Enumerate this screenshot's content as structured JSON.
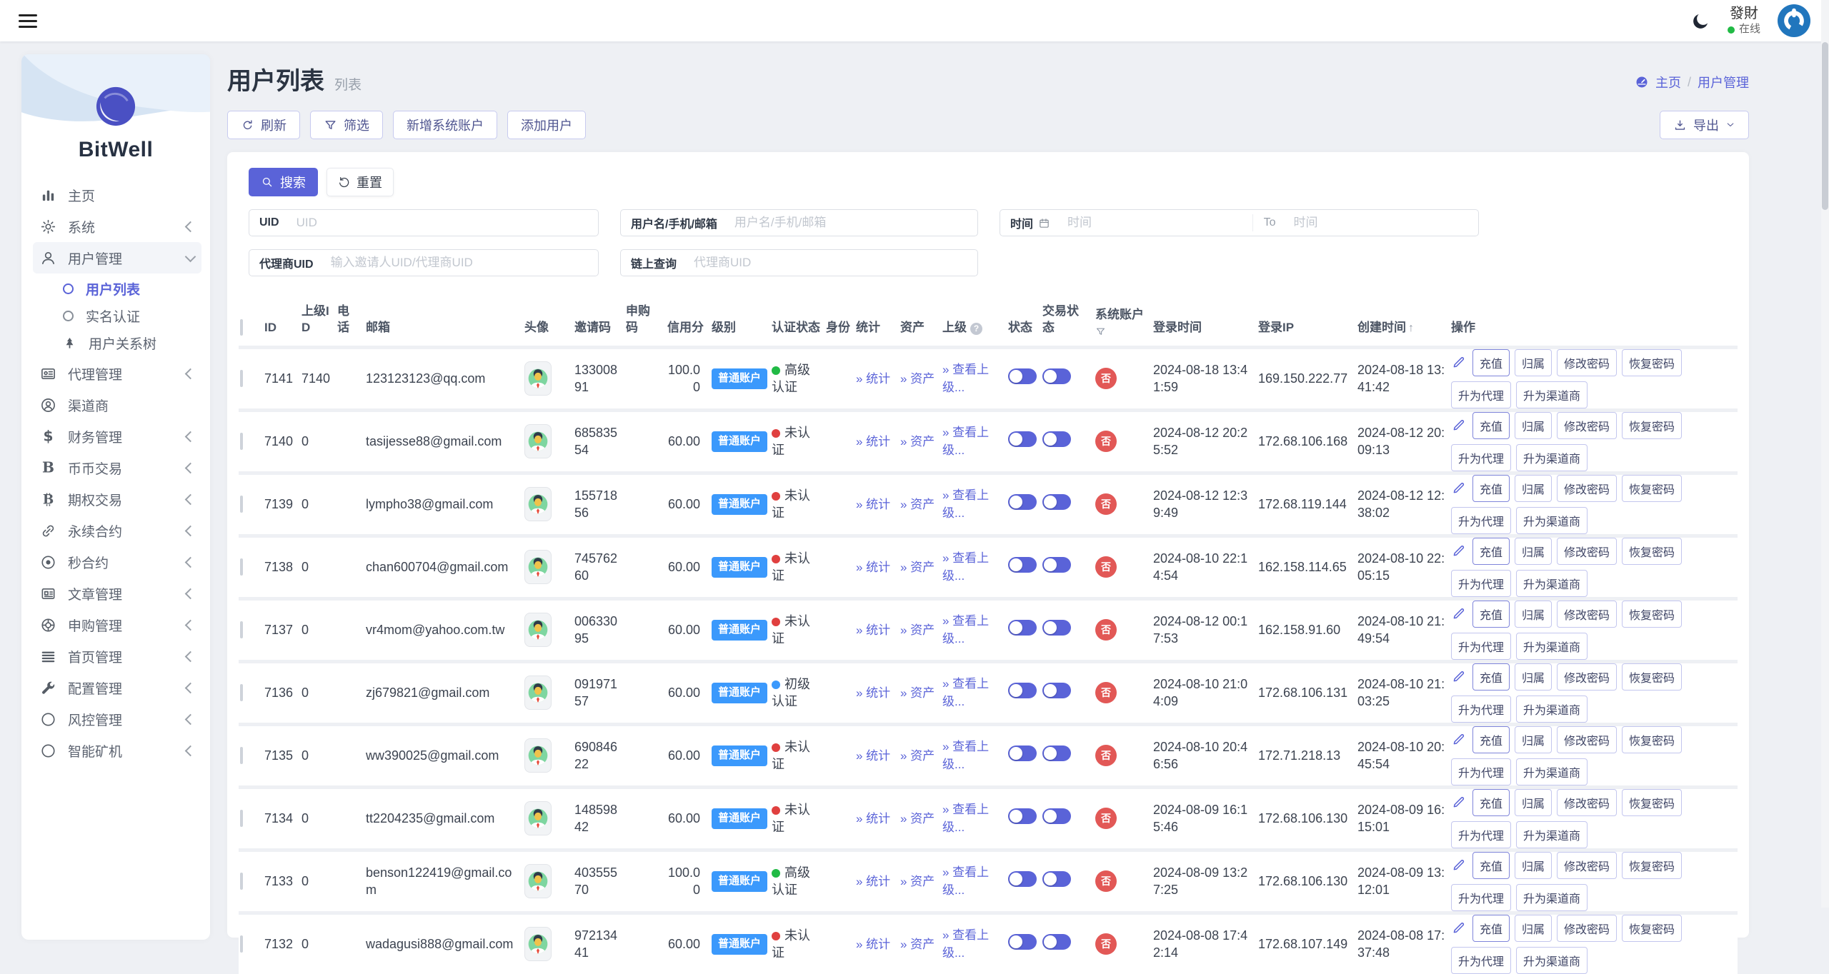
{
  "topbar": {
    "user_name": "發財",
    "user_status": "在线"
  },
  "sidebar": {
    "brand": "BitWell",
    "menu": [
      {
        "icon": "chart-bars-icon",
        "label": "主页"
      },
      {
        "icon": "gear-icon",
        "label": "系统",
        "chevron": "left"
      },
      {
        "icon": "user-icon",
        "label": "用户管理",
        "chevron": "down",
        "open": true,
        "children": [
          {
            "label": "用户列表",
            "active": true
          },
          {
            "label": "实名认证"
          },
          {
            "label": "用户关系树",
            "icon": "tree-icon"
          }
        ]
      },
      {
        "icon": "id-card-icon",
        "label": "代理管理",
        "chevron": "left"
      },
      {
        "icon": "person-circle-icon",
        "label": "渠道商"
      },
      {
        "icon": "dollar-icon",
        "label": "财务管理",
        "chevron": "left"
      },
      {
        "icon": "b-letter-icon",
        "label": "币币交易",
        "chevron": "left"
      },
      {
        "icon": "bitcoin-icon",
        "label": "期权交易",
        "chevron": "left"
      },
      {
        "icon": "chain-link-icon",
        "label": "永续合约",
        "chevron": "left"
      },
      {
        "icon": "target-icon",
        "label": "秒合约",
        "chevron": "left"
      },
      {
        "icon": "article-icon",
        "label": "文章管理",
        "chevron": "left"
      },
      {
        "icon": "lifebuoy-icon",
        "label": "申购管理",
        "chevron": "left"
      },
      {
        "icon": "list-icon",
        "label": "首页管理",
        "chevron": "left"
      },
      {
        "icon": "wrench-icon",
        "label": "配置管理",
        "chevron": "left"
      },
      {
        "icon": "circle-icon",
        "label": "风控管理",
        "chevron": "left"
      },
      {
        "icon": "circle-icon",
        "label": "智能矿机",
        "chevron": "left"
      }
    ]
  },
  "page": {
    "title": "用户列表",
    "subtitle": "列表",
    "breadcrumb": {
      "home": "主页",
      "separator": "/",
      "current": "用户管理"
    }
  },
  "toolbar": {
    "refresh": "刷新",
    "filter": "筛选",
    "new_system_account": "新增系统账户",
    "add_user": "添加用户",
    "export": "导出"
  },
  "search": {
    "search_button": "搜索",
    "reset_button": "重置",
    "uid": {
      "label": "UID",
      "placeholder": "UID",
      "value": ""
    },
    "user": {
      "label": "用户名/手机/邮箱",
      "placeholder": "用户名/手机/邮箱",
      "value": ""
    },
    "time": {
      "label": "时间",
      "placeholder_start": "时间",
      "separator": "To",
      "placeholder_end": "时间",
      "value_start": "",
      "value_end": ""
    },
    "agent_uid": {
      "label": "代理商UID",
      "placeholder": "输入邀请人UID/代理商UID",
      "value": ""
    },
    "onchain": {
      "label": "链上查询",
      "placeholder": "代理商UID",
      "value": ""
    }
  },
  "table": {
    "columns": [
      {
        "label": "ID"
      },
      {
        "label": "上级ID"
      },
      {
        "label": "电话"
      },
      {
        "label": "邮箱"
      },
      {
        "label": "头像"
      },
      {
        "label": "邀请码"
      },
      {
        "label": "申购码"
      },
      {
        "label": "信用分"
      },
      {
        "label": "级别"
      },
      {
        "label": "认证状态"
      },
      {
        "label": "身份"
      },
      {
        "label": "统计"
      },
      {
        "label": "资产"
      },
      {
        "label": "上级",
        "suffix": "question"
      },
      {
        "label": "状态"
      },
      {
        "label": "交易状态"
      },
      {
        "label": "系统账户",
        "suffix": "funnel"
      },
      {
        "label": "登录时间"
      },
      {
        "label": "登录IP"
      },
      {
        "label": "创建时间",
        "suffix": "sort-asc"
      },
      {
        "label": "操作"
      }
    ],
    "row_links": {
      "stats": "统计",
      "assets": "资产",
      "view_parent": "查看上级..."
    },
    "level_badge_label": "普通账户",
    "system_account_badge": "否",
    "auth_labels": {
      "none": "未认证",
      "junior": "初级认证",
      "senior": "高级认证"
    },
    "actions": [
      "充值",
      "归属",
      "修改密码",
      "恢复密码",
      "升为代理",
      "升为渠道商"
    ],
    "rows": [
      {
        "id": "7141",
        "parent_id": "7140",
        "phone": "",
        "email": "123123123@qq.com",
        "invite_code": "13300891",
        "purchase_code": "",
        "credit": "100.00",
        "auth": "senior",
        "identity": "",
        "status_on": true,
        "trade_on": true,
        "system_account": "否",
        "login_time": "2024-08-18 13:41:59",
        "login_ip": "169.150.222.77",
        "created_at": "2024-08-18 13:41:42"
      },
      {
        "id": "7140",
        "parent_id": "0",
        "phone": "",
        "email": "tasijesse88@gmail.com",
        "invite_code": "68583554",
        "purchase_code": "",
        "credit": "60.00",
        "auth": "none",
        "identity": "",
        "status_on": true,
        "trade_on": true,
        "system_account": "否",
        "login_time": "2024-08-12 20:25:52",
        "login_ip": "172.68.106.168",
        "created_at": "2024-08-12 20:09:13"
      },
      {
        "id": "7139",
        "parent_id": "0",
        "phone": "",
        "email": "lympho38@gmail.com",
        "invite_code": "15571856",
        "purchase_code": "",
        "credit": "60.00",
        "auth": "none",
        "identity": "",
        "status_on": true,
        "trade_on": true,
        "system_account": "否",
        "login_time": "2024-08-12 12:39:49",
        "login_ip": "172.68.119.144",
        "created_at": "2024-08-12 12:38:02"
      },
      {
        "id": "7138",
        "parent_id": "0",
        "phone": "",
        "email": "chan600704@gmail.com",
        "invite_code": "74576260",
        "purchase_code": "",
        "credit": "60.00",
        "auth": "none",
        "identity": "",
        "status_on": true,
        "trade_on": true,
        "system_account": "否",
        "login_time": "2024-08-10 22:14:54",
        "login_ip": "162.158.114.65",
        "created_at": "2024-08-10 22:05:15"
      },
      {
        "id": "7137",
        "parent_id": "0",
        "phone": "",
        "email": "vr4mom@yahoo.com.tw",
        "invite_code": "00633095",
        "purchase_code": "",
        "credit": "60.00",
        "auth": "none",
        "identity": "",
        "status_on": true,
        "trade_on": true,
        "system_account": "否",
        "login_time": "2024-08-12 00:17:53",
        "login_ip": "162.158.91.60",
        "created_at": "2024-08-10 21:49:54"
      },
      {
        "id": "7136",
        "parent_id": "0",
        "phone": "",
        "email": "zj679821@gmail.com",
        "invite_code": "09197157",
        "purchase_code": "",
        "credit": "60.00",
        "auth": "junior",
        "identity": "",
        "status_on": true,
        "trade_on": true,
        "system_account": "否",
        "login_time": "2024-08-10 21:04:09",
        "login_ip": "172.68.106.131",
        "created_at": "2024-08-10 21:03:25"
      },
      {
        "id": "7135",
        "parent_id": "0",
        "phone": "",
        "email": "ww390025@gmail.com",
        "invite_code": "69084622",
        "purchase_code": "",
        "credit": "60.00",
        "auth": "none",
        "identity": "",
        "status_on": true,
        "trade_on": true,
        "system_account": "否",
        "login_time": "2024-08-10 20:46:56",
        "login_ip": "172.71.218.13",
        "created_at": "2024-08-10 20:45:54"
      },
      {
        "id": "7134",
        "parent_id": "0",
        "phone": "",
        "email": "tt2204235@gmail.com",
        "invite_code": "14859842",
        "purchase_code": "",
        "credit": "60.00",
        "auth": "none",
        "identity": "",
        "status_on": true,
        "trade_on": true,
        "system_account": "否",
        "login_time": "2024-08-09 16:15:46",
        "login_ip": "172.68.106.130",
        "created_at": "2024-08-09 16:15:01"
      },
      {
        "id": "7133",
        "parent_id": "0",
        "phone": "",
        "email": "benson122419@gmail.com",
        "invite_code": "40355570",
        "purchase_code": "",
        "credit": "100.00",
        "auth": "senior",
        "identity": "",
        "status_on": true,
        "trade_on": true,
        "system_account": "否",
        "login_time": "2024-08-09 13:27:25",
        "login_ip": "172.68.106.130",
        "created_at": "2024-08-09 13:12:01"
      },
      {
        "id": "7132",
        "parent_id": "0",
        "phone": "",
        "email": "wadagusi888@gmail.com",
        "invite_code": "97213441",
        "purchase_code": "",
        "credit": "60.00",
        "auth": "none",
        "identity": "",
        "status_on": true,
        "trade_on": true,
        "system_account": "否",
        "login_time": "2024-08-08 17:42:14",
        "login_ip": "172.68.107.149",
        "created_at": "2024-08-08 17:37:48"
      }
    ]
  },
  "colors": {
    "accent": "#5a63d8",
    "level_badge": "#3b99fc",
    "auth_none": "#e0403f",
    "auth_junior": "#3b99fc",
    "auth_senior": "#21ba45",
    "system_badge": "#e25856",
    "toggle_on": "#5a63d8",
    "online_dot": "#21ba45"
  }
}
